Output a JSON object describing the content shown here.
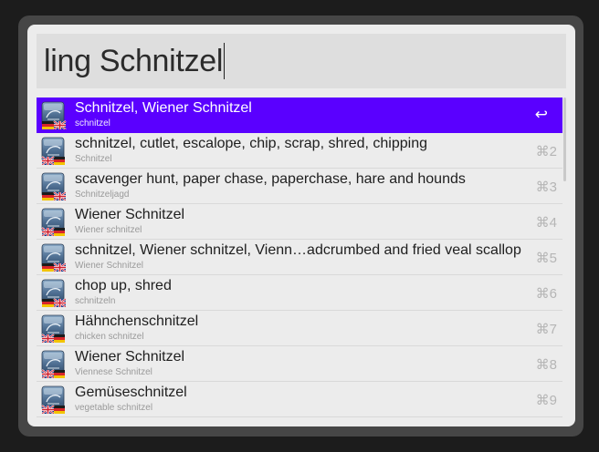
{
  "search": {
    "query": "ling Schnitzel"
  },
  "results": [
    {
      "title": "Schnitzel, Wiener Schnitzel",
      "subtitle": "schnitzel",
      "shortcut": "↩",
      "flag": "de-en",
      "selected": true
    },
    {
      "title": "schnitzel, cutlet, escalope, chip, scrap, shred, chipping",
      "subtitle": "Schnitzel",
      "shortcut": "⌘2",
      "flag": "en-de"
    },
    {
      "title": "scavenger hunt, paper chase, paperchase, hare and hounds",
      "subtitle": "Schnitzeljagd",
      "shortcut": "⌘3",
      "flag": "de-en"
    },
    {
      "title": "Wiener Schnitzel",
      "subtitle": "Wiener schnitzel",
      "shortcut": "⌘4",
      "flag": "en-de"
    },
    {
      "title": "schnitzel, Wiener schnitzel, Vienn…adcrumbed and fried veal scallop",
      "subtitle": "Wiener Schnitzel",
      "shortcut": "⌘5",
      "flag": "de-en"
    },
    {
      "title": "chop up, shred",
      "subtitle": "schnitzeln",
      "shortcut": "⌘6",
      "flag": "de-en"
    },
    {
      "title": "Hähnchenschnitzel",
      "subtitle": "chicken schnitzel",
      "shortcut": "⌘7",
      "flag": "en-de"
    },
    {
      "title": "Wiener Schnitzel",
      "subtitle": "Viennese Schnitzel",
      "shortcut": "⌘8",
      "flag": "en-de"
    },
    {
      "title": "Gemüseschnitzel",
      "subtitle": "vegetable schnitzel",
      "shortcut": "⌘9",
      "flag": "en-de"
    }
  ],
  "colors": {
    "selection": "#5a00ff",
    "panel": "#ececec",
    "frame": "#464646"
  }
}
